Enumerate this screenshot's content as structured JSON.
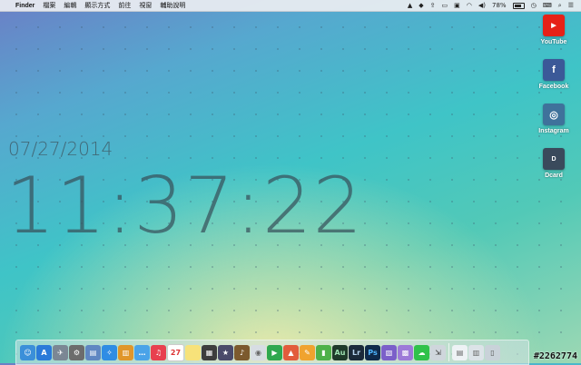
{
  "menubar": {
    "app_name": "Finder",
    "menus": [
      "檔案",
      "編輯",
      "顯示方式",
      "前往",
      "視窗",
      "輔助說明"
    ],
    "battery_percent": "78%"
  },
  "clock": {
    "date": "07/27/2014",
    "time": "11:37:22"
  },
  "desktop_icons": [
    {
      "label": "YouTube",
      "icon": "youtube-icon",
      "color": "#e62117"
    },
    {
      "label": "Facebook",
      "icon": "facebook-icon",
      "color": "#3b5998"
    },
    {
      "label": "Instagram",
      "icon": "instagram-icon",
      "color": "#3f729b"
    },
    {
      "label": "Dcard",
      "icon": "dcard-icon",
      "color": "#3a4a5c"
    }
  ],
  "dock_badges": {
    "calendar_day": "27",
    "audition": "Au",
    "lightroom": "Lr",
    "photoshop": "Ps"
  },
  "watermark": "#2262774"
}
